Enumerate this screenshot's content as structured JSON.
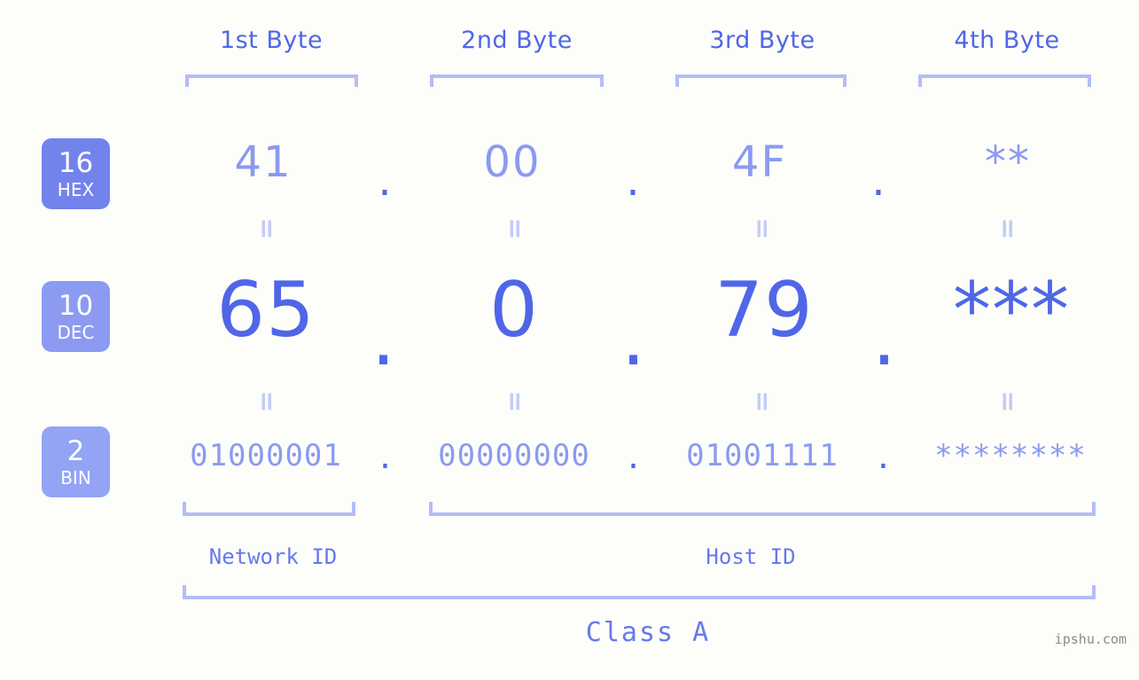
{
  "meta": {
    "watermark": "ipshu.com",
    "background_color": "#fdfefa",
    "accent_strong": "#4f66e8",
    "accent_light": "#8b9af0",
    "bracket_color": "#b3bdf5"
  },
  "byte_headers": [
    {
      "label": "1st Byte"
    },
    {
      "label": "2nd Byte"
    },
    {
      "label": "3rd Byte"
    },
    {
      "label": "4th Byte"
    }
  ],
  "bases": [
    {
      "number": "16",
      "abbr": "HEX",
      "color": "#7383ec"
    },
    {
      "number": "10",
      "abbr": "DEC",
      "color": "#8c9bf1"
    },
    {
      "number": "2",
      "abbr": "BIN",
      "color": "#93a4f5"
    }
  ],
  "separator": ".",
  "equals_glyph": "=",
  "rows": {
    "hex": {
      "values": [
        "41",
        "00",
        "4F",
        "**"
      ]
    },
    "dec": {
      "values": [
        "65",
        "0",
        "79",
        "***"
      ]
    },
    "bin": {
      "values": [
        "01000001",
        "00000000",
        "01001111",
        "********"
      ]
    }
  },
  "footer": {
    "network_id": "Network ID",
    "host_id": "Host ID",
    "class": "Class A"
  }
}
